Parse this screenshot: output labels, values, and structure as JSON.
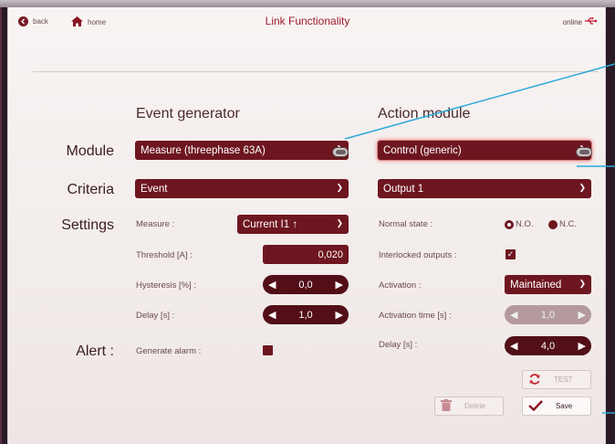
{
  "header": {
    "back_label": "back",
    "home_label": "home",
    "title": "Link Functionality",
    "status_label": "online"
  },
  "columns": {
    "event_generator": "Event generator",
    "action_module": "Action module"
  },
  "rows": {
    "module": "Module",
    "criteria": "Criteria",
    "settings": "Settings",
    "alert": "Alert :"
  },
  "event": {
    "module_select": "Measure (threephase 63A)",
    "criteria_select": "Event",
    "measure_label": "Measure :",
    "measure_value": "Current I1 ↑",
    "threshold_label": "Threshold [A]  :",
    "threshold_value": "0,020",
    "hysteresis_label": "Hysteresis [%] :",
    "hysteresis_value": "0,0",
    "delay_label": "Delay [s] :",
    "delay_value": "1,0",
    "generate_alarm_label": "Generate alarm :"
  },
  "action": {
    "module_select": "Control (generic)",
    "output_select": "Output 1",
    "normal_state_label": "Normal state :",
    "no_label": "N.O.",
    "nc_label": "N.C.",
    "interlocked_label": "Interlocked outputs :",
    "activation_label": "Activation :",
    "activation_value": "Maintained",
    "activation_time_label": "Activation time [s] :",
    "activation_time_value": "1,0",
    "delay_label": "Delay [s] :",
    "delay_value": "4,0",
    "test_label": "TEST",
    "delete_label": "Delete",
    "save_label": "Save"
  },
  "colors": {
    "accent": "#6e1620",
    "title": "#9c1c2a",
    "connector": "#2ca8d8"
  },
  "icons": [
    "back-icon",
    "home-icon",
    "usb-icon",
    "chevron-down-icon",
    "toggle-icon",
    "refresh-icon",
    "trash-icon",
    "checkmark-icon"
  ]
}
